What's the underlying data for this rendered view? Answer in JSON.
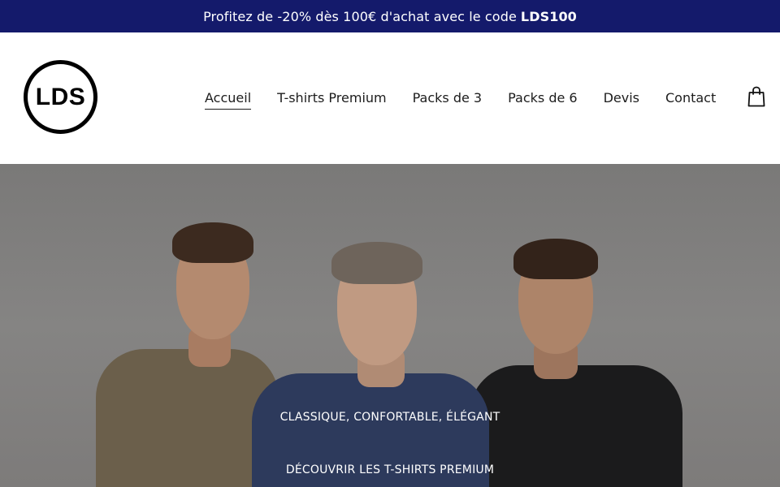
{
  "announcement": {
    "text": "Profitez de -20% dès 100€ d'achat avec le code",
    "code": "LDS100"
  },
  "logo": {
    "text": "LDS"
  },
  "nav": {
    "items": [
      {
        "label": "Accueil",
        "active": true
      },
      {
        "label": "T-shirts Premium"
      },
      {
        "label": "Packs de 3"
      },
      {
        "label": "Packs de 6"
      },
      {
        "label": "Devis"
      },
      {
        "label": "Contact"
      }
    ],
    "cart_icon": "shopping-bag-icon"
  },
  "hero": {
    "tagline": "CLASSIQUE, CONFORTABLE, ÉLÉGANT",
    "cta_label": "DÉCOUVRIR LES T-SHIRTS PREMIUM",
    "colors": {
      "background": "#808080",
      "shirt_left": "#6b5f4b",
      "shirt_center": "#2d3a5c",
      "shirt_right": "#1b1b1c"
    }
  },
  "colors": {
    "announcement_bg": "#141a6b",
    "text": "#1c1c1c"
  }
}
